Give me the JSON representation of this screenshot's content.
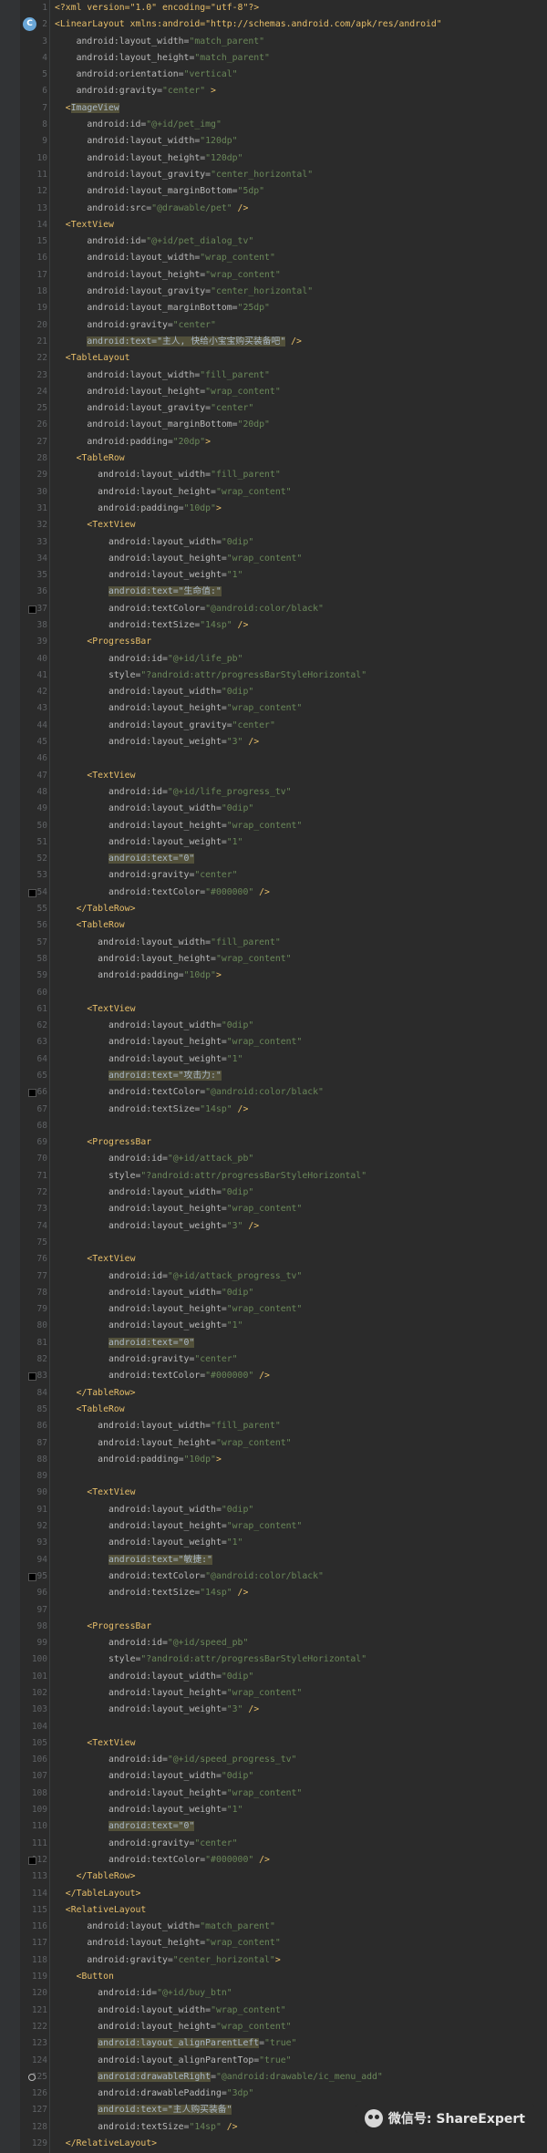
{
  "editor": {
    "lines": [
      [
        [
          "p",
          "<?xml version=\"1.0\" encoding=\"utf-8\"?>"
        ]
      ],
      [
        [
          "t",
          "<LinearLayout xmlns:android=\"http://schemas.android.com/apk/res/android\""
        ]
      ],
      [
        [
          "a",
          "    android:layout_width="
        ],
        [
          "v",
          "\"match_parent\""
        ]
      ],
      [
        [
          "a",
          "    android:layout_height="
        ],
        [
          "v",
          "\"match_parent\""
        ]
      ],
      [
        [
          "a",
          "    android:orientation="
        ],
        [
          "v",
          "\"vertical\""
        ]
      ],
      [
        [
          "a",
          "    android:gravity="
        ],
        [
          "v",
          "\"center\""
        ],
        [
          "t",
          " >"
        ]
      ],
      [
        [
          "t",
          "  <"
        ],
        [
          "hl",
          "ImageView"
        ]
      ],
      [
        [
          "a",
          "      android:id="
        ],
        [
          "v",
          "\"@+id/pet_img\""
        ]
      ],
      [
        [
          "a",
          "      android:layout_width="
        ],
        [
          "v",
          "\"120dp\""
        ]
      ],
      [
        [
          "a",
          "      android:layout_height="
        ],
        [
          "v",
          "\"120dp\""
        ]
      ],
      [
        [
          "a",
          "      android:layout_gravity="
        ],
        [
          "v",
          "\"center_horizontal\""
        ]
      ],
      [
        [
          "a",
          "      android:layout_marginBottom="
        ],
        [
          "v",
          "\"5dp\""
        ]
      ],
      [
        [
          "a",
          "      android:src="
        ],
        [
          "v",
          "\"@drawable/pet\""
        ],
        [
          "t",
          " />"
        ]
      ],
      [
        [
          "t",
          "  <TextView"
        ]
      ],
      [
        [
          "a",
          "      android:id="
        ],
        [
          "v",
          "\"@+id/pet_dialog_tv\""
        ]
      ],
      [
        [
          "a",
          "      android:layout_width="
        ],
        [
          "v",
          "\"wrap_content\""
        ]
      ],
      [
        [
          "a",
          "      android:layout_height="
        ],
        [
          "v",
          "\"wrap_content\""
        ]
      ],
      [
        [
          "a",
          "      android:layout_gravity="
        ],
        [
          "v",
          "\"center_horizontal\""
        ]
      ],
      [
        [
          "a",
          "      android:layout_marginBottom="
        ],
        [
          "v",
          "\"25dp\""
        ]
      ],
      [
        [
          "a",
          "      android:gravity="
        ],
        [
          "v",
          "\"center\""
        ]
      ],
      [
        [
          "a",
          "      "
        ],
        [
          "hl",
          "android:text=\"主人, 快给小宝宝购买装备吧\""
        ],
        [
          "t",
          " />"
        ]
      ],
      [
        [
          "t",
          "  <TableLayout"
        ]
      ],
      [
        [
          "a",
          "      android:layout_width="
        ],
        [
          "v",
          "\"fill_parent\""
        ]
      ],
      [
        [
          "a",
          "      android:layout_height="
        ],
        [
          "v",
          "\"wrap_content\""
        ]
      ],
      [
        [
          "a",
          "      android:layout_gravity="
        ],
        [
          "v",
          "\"center\""
        ]
      ],
      [
        [
          "a",
          "      android:layout_marginBottom="
        ],
        [
          "v",
          "\"20dp\""
        ]
      ],
      [
        [
          "a",
          "      android:padding="
        ],
        [
          "v",
          "\"20dp\""
        ],
        [
          "t",
          ">"
        ]
      ],
      [
        [
          "t",
          "    <TableRow"
        ]
      ],
      [
        [
          "a",
          "        android:layout_width="
        ],
        [
          "v",
          "\"fill_parent\""
        ]
      ],
      [
        [
          "a",
          "        android:layout_height="
        ],
        [
          "v",
          "\"wrap_content\""
        ]
      ],
      [
        [
          "a",
          "        android:padding="
        ],
        [
          "v",
          "\"10dp\""
        ],
        [
          "t",
          ">"
        ]
      ],
      [
        [
          "t",
          "      <TextView"
        ]
      ],
      [
        [
          "a",
          "          android:layout_width="
        ],
        [
          "v",
          "\"0dip\""
        ]
      ],
      [
        [
          "a",
          "          android:layout_height="
        ],
        [
          "v",
          "\"wrap_content\""
        ]
      ],
      [
        [
          "a",
          "          android:layout_weight="
        ],
        [
          "v",
          "\"1\""
        ]
      ],
      [
        [
          "a",
          "          "
        ],
        [
          "hl",
          "android:text=\"生命值:\""
        ]
      ],
      [
        [
          "a",
          "          android:textColor="
        ],
        [
          "v",
          "\"@android:color/black\""
        ]
      ],
      [
        [
          "a",
          "          android:textSize="
        ],
        [
          "v",
          "\"14sp\""
        ],
        [
          "t",
          " />"
        ]
      ],
      [
        [
          "t",
          "      <ProgressBar"
        ]
      ],
      [
        [
          "a",
          "          android:id="
        ],
        [
          "v",
          "\"@+id/life_pb\""
        ]
      ],
      [
        [
          "a",
          "          style="
        ],
        [
          "v",
          "\"?android:attr/progressBarStyleHorizontal\""
        ]
      ],
      [
        [
          "a",
          "          android:layout_width="
        ],
        [
          "v",
          "\"0dip\""
        ]
      ],
      [
        [
          "a",
          "          android:layout_height="
        ],
        [
          "v",
          "\"wrap_content\""
        ]
      ],
      [
        [
          "a",
          "          android:layout_gravity="
        ],
        [
          "v",
          "\"center\""
        ]
      ],
      [
        [
          "a",
          "          android:layout_weight="
        ],
        [
          "v",
          "\"3\""
        ],
        [
          "t",
          " />"
        ]
      ],
      [],
      [
        [
          "t",
          "      <TextView"
        ]
      ],
      [
        [
          "a",
          "          android:id="
        ],
        [
          "v",
          "\"@+id/life_progress_tv\""
        ]
      ],
      [
        [
          "a",
          "          android:layout_width="
        ],
        [
          "v",
          "\"0dip\""
        ]
      ],
      [
        [
          "a",
          "          android:layout_height="
        ],
        [
          "v",
          "\"wrap_content\""
        ]
      ],
      [
        [
          "a",
          "          android:layout_weight="
        ],
        [
          "v",
          "\"1\""
        ]
      ],
      [
        [
          "a",
          "          "
        ],
        [
          "hl",
          "android:text=\"0\""
        ]
      ],
      [
        [
          "a",
          "          android:gravity="
        ],
        [
          "v",
          "\"center\""
        ]
      ],
      [
        [
          "a",
          "          android:textColor="
        ],
        [
          "v",
          "\"#000000\""
        ],
        [
          "t",
          " />"
        ]
      ],
      [
        [
          "t",
          "    </TableRow>"
        ]
      ],
      [
        [
          "t",
          "    <TableRow"
        ]
      ],
      [
        [
          "a",
          "        android:layout_width="
        ],
        [
          "v",
          "\"fill_parent\""
        ]
      ],
      [
        [
          "a",
          "        android:layout_height="
        ],
        [
          "v",
          "\"wrap_content\""
        ]
      ],
      [
        [
          "a",
          "        android:padding="
        ],
        [
          "v",
          "\"10dp\""
        ],
        [
          "t",
          ">"
        ]
      ],
      [],
      [
        [
          "t",
          "      <TextView"
        ]
      ],
      [
        [
          "a",
          "          android:layout_width="
        ],
        [
          "v",
          "\"0dip\""
        ]
      ],
      [
        [
          "a",
          "          android:layout_height="
        ],
        [
          "v",
          "\"wrap_content\""
        ]
      ],
      [
        [
          "a",
          "          android:layout_weight="
        ],
        [
          "v",
          "\"1\""
        ]
      ],
      [
        [
          "a",
          "          "
        ],
        [
          "hl",
          "android:text=\"攻击力:\""
        ]
      ],
      [
        [
          "a",
          "          android:textColor="
        ],
        [
          "v",
          "\"@android:color/black\""
        ]
      ],
      [
        [
          "a",
          "          android:textSize="
        ],
        [
          "v",
          "\"14sp\""
        ],
        [
          "t",
          " />"
        ]
      ],
      [],
      [
        [
          "t",
          "      <ProgressBar"
        ]
      ],
      [
        [
          "a",
          "          android:id="
        ],
        [
          "v",
          "\"@+id/attack_pb\""
        ]
      ],
      [
        [
          "a",
          "          style="
        ],
        [
          "v",
          "\"?android:attr/progressBarStyleHorizontal\""
        ]
      ],
      [
        [
          "a",
          "          android:layout_width="
        ],
        [
          "v",
          "\"0dip\""
        ]
      ],
      [
        [
          "a",
          "          android:layout_height="
        ],
        [
          "v",
          "\"wrap_content\""
        ]
      ],
      [
        [
          "a",
          "          android:layout_weight="
        ],
        [
          "v",
          "\"3\""
        ],
        [
          "t",
          " />"
        ]
      ],
      [],
      [
        [
          "t",
          "      <TextView"
        ]
      ],
      [
        [
          "a",
          "          android:id="
        ],
        [
          "v",
          "\"@+id/attack_progress_tv\""
        ]
      ],
      [
        [
          "a",
          "          android:layout_width="
        ],
        [
          "v",
          "\"0dip\""
        ]
      ],
      [
        [
          "a",
          "          android:layout_height="
        ],
        [
          "v",
          "\"wrap_content\""
        ]
      ],
      [
        [
          "a",
          "          android:layout_weight="
        ],
        [
          "v",
          "\"1\""
        ]
      ],
      [
        [
          "a",
          "          "
        ],
        [
          "hl",
          "android:text=\"0\""
        ]
      ],
      [
        [
          "a",
          "          android:gravity="
        ],
        [
          "v",
          "\"center\""
        ]
      ],
      [
        [
          "a",
          "          android:textColor="
        ],
        [
          "v",
          "\"#000000\""
        ],
        [
          "t",
          " />"
        ]
      ],
      [
        [
          "t",
          "    </TableRow>"
        ]
      ],
      [
        [
          "t",
          "    <TableRow"
        ]
      ],
      [
        [
          "a",
          "        android:layout_width="
        ],
        [
          "v",
          "\"fill_parent\""
        ]
      ],
      [
        [
          "a",
          "        android:layout_height="
        ],
        [
          "v",
          "\"wrap_content\""
        ]
      ],
      [
        [
          "a",
          "        android:padding="
        ],
        [
          "v",
          "\"10dp\""
        ],
        [
          "t",
          ">"
        ]
      ],
      [],
      [
        [
          "t",
          "      <TextView"
        ]
      ],
      [
        [
          "a",
          "          android:layout_width="
        ],
        [
          "v",
          "\"0dip\""
        ]
      ],
      [
        [
          "a",
          "          android:layout_height="
        ],
        [
          "v",
          "\"wrap_content\""
        ]
      ],
      [
        [
          "a",
          "          android:layout_weight="
        ],
        [
          "v",
          "\"1\""
        ]
      ],
      [
        [
          "a",
          "          "
        ],
        [
          "hl",
          "android:text=\"敏捷:\""
        ]
      ],
      [
        [
          "a",
          "          android:textColor="
        ],
        [
          "v",
          "\"@android:color/black\""
        ]
      ],
      [
        [
          "a",
          "          android:textSize="
        ],
        [
          "v",
          "\"14sp\""
        ],
        [
          "t",
          " />"
        ]
      ],
      [],
      [
        [
          "t",
          "      <ProgressBar"
        ]
      ],
      [
        [
          "a",
          "          android:id="
        ],
        [
          "v",
          "\"@+id/speed_pb\""
        ]
      ],
      [
        [
          "a",
          "          style="
        ],
        [
          "v",
          "\"?android:attr/progressBarStyleHorizontal\""
        ]
      ],
      [
        [
          "a",
          "          android:layout_width="
        ],
        [
          "v",
          "\"0dip\""
        ]
      ],
      [
        [
          "a",
          "          android:layout_height="
        ],
        [
          "v",
          "\"wrap_content\""
        ]
      ],
      [
        [
          "a",
          "          android:layout_weight="
        ],
        [
          "v",
          "\"3\""
        ],
        [
          "t",
          " />"
        ]
      ],
      [],
      [
        [
          "t",
          "      <TextView"
        ]
      ],
      [
        [
          "a",
          "          android:id="
        ],
        [
          "v",
          "\"@+id/speed_progress_tv\""
        ]
      ],
      [
        [
          "a",
          "          android:layout_width="
        ],
        [
          "v",
          "\"0dip\""
        ]
      ],
      [
        [
          "a",
          "          android:layout_height="
        ],
        [
          "v",
          "\"wrap_content\""
        ]
      ],
      [
        [
          "a",
          "          android:layout_weight="
        ],
        [
          "v",
          "\"1\""
        ]
      ],
      [
        [
          "a",
          "          "
        ],
        [
          "hl",
          "android:text=\"0\""
        ]
      ],
      [
        [
          "a",
          "          android:gravity="
        ],
        [
          "v",
          "\"center\""
        ]
      ],
      [
        [
          "a",
          "          android:textColor="
        ],
        [
          "v",
          "\"#000000\""
        ],
        [
          "t",
          " />"
        ]
      ],
      [
        [
          "t",
          "    </TableRow>"
        ]
      ],
      [
        [
          "t",
          "  </TableLayout>"
        ]
      ],
      [
        [
          "t",
          "  <RelativeLayout"
        ]
      ],
      [
        [
          "a",
          "      android:layout_width="
        ],
        [
          "v",
          "\"match_parent\""
        ]
      ],
      [
        [
          "a",
          "      android:layout_height="
        ],
        [
          "v",
          "\"wrap_content\""
        ]
      ],
      [
        [
          "a",
          "      android:gravity="
        ],
        [
          "v",
          "\"center_horizontal\""
        ],
        [
          "t",
          ">"
        ]
      ],
      [
        [
          "t",
          "    <Button"
        ]
      ],
      [
        [
          "a",
          "        android:id="
        ],
        [
          "v",
          "\"@+id/buy_btn\""
        ]
      ],
      [
        [
          "a",
          "        android:layout_width="
        ],
        [
          "v",
          "\"wrap_content\""
        ]
      ],
      [
        [
          "a",
          "        android:layout_height="
        ],
        [
          "v",
          "\"wrap_content\""
        ]
      ],
      [
        [
          "a",
          "        "
        ],
        [
          "hl",
          "android:layout_alignParentLeft"
        ],
        [
          "a",
          "="
        ],
        [
          "v",
          "\"true\""
        ]
      ],
      [
        [
          "a",
          "        android:layout_alignParentTop="
        ],
        [
          "v",
          "\"true\""
        ]
      ],
      [
        [
          "a",
          "        "
        ],
        [
          "hl",
          "android:drawableRight"
        ],
        [
          "a",
          "="
        ],
        [
          "v",
          "\"@android:drawable/ic_menu_add\""
        ]
      ],
      [
        [
          "a",
          "        android:drawablePadding="
        ],
        [
          "v",
          "\"3dp\""
        ]
      ],
      [
        [
          "a",
          "        "
        ],
        [
          "hl",
          "android:text=\"主人购买装备\""
        ]
      ],
      [
        [
          "a",
          "        android:textSize="
        ],
        [
          "v",
          "\"14sp\""
        ],
        [
          "t",
          " />"
        ]
      ],
      [
        [
          "t",
          "  </RelativeLayout>"
        ]
      ],
      [
        [
          "t",
          "</LinearLayout>"
        ]
      ]
    ]
  },
  "gutter": {
    "class_icon_line": 2,
    "class_icon_letter": "C",
    "color_swatch_lines": [
      37,
      54,
      66,
      83,
      95,
      112
    ],
    "breakpoint_line": 125
  },
  "watermark": {
    "icon": "wechat-icon",
    "text": "微信号: ShareExpert"
  },
  "colors": {
    "background": "#2b2b2b",
    "gutter": "#313335",
    "tag": "#e8bf6a",
    "attribute": "#bababa",
    "value": "#6a8759",
    "highlight": "#52503a",
    "line_number": "#606366"
  }
}
